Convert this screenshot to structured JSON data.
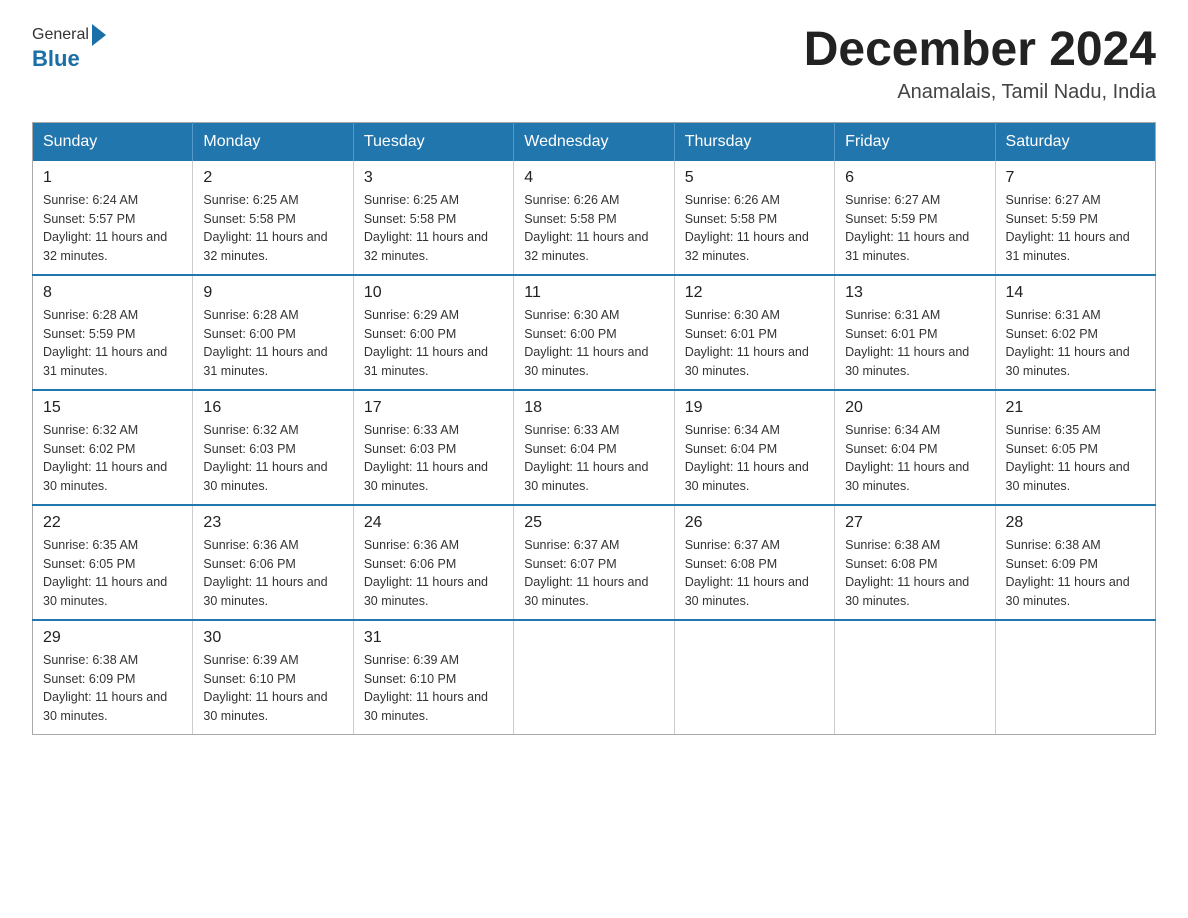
{
  "header": {
    "logo_general": "General",
    "logo_blue": "Blue",
    "month_title": "December 2024",
    "location": "Anamalais, Tamil Nadu, India"
  },
  "days_of_week": [
    "Sunday",
    "Monday",
    "Tuesday",
    "Wednesday",
    "Thursday",
    "Friday",
    "Saturday"
  ],
  "weeks": [
    [
      {
        "day": "1",
        "sunrise": "Sunrise: 6:24 AM",
        "sunset": "Sunset: 5:57 PM",
        "daylight": "Daylight: 11 hours and 32 minutes."
      },
      {
        "day": "2",
        "sunrise": "Sunrise: 6:25 AM",
        "sunset": "Sunset: 5:58 PM",
        "daylight": "Daylight: 11 hours and 32 minutes."
      },
      {
        "day": "3",
        "sunrise": "Sunrise: 6:25 AM",
        "sunset": "Sunset: 5:58 PM",
        "daylight": "Daylight: 11 hours and 32 minutes."
      },
      {
        "day": "4",
        "sunrise": "Sunrise: 6:26 AM",
        "sunset": "Sunset: 5:58 PM",
        "daylight": "Daylight: 11 hours and 32 minutes."
      },
      {
        "day": "5",
        "sunrise": "Sunrise: 6:26 AM",
        "sunset": "Sunset: 5:58 PM",
        "daylight": "Daylight: 11 hours and 32 minutes."
      },
      {
        "day": "6",
        "sunrise": "Sunrise: 6:27 AM",
        "sunset": "Sunset: 5:59 PM",
        "daylight": "Daylight: 11 hours and 31 minutes."
      },
      {
        "day": "7",
        "sunrise": "Sunrise: 6:27 AM",
        "sunset": "Sunset: 5:59 PM",
        "daylight": "Daylight: 11 hours and 31 minutes."
      }
    ],
    [
      {
        "day": "8",
        "sunrise": "Sunrise: 6:28 AM",
        "sunset": "Sunset: 5:59 PM",
        "daylight": "Daylight: 11 hours and 31 minutes."
      },
      {
        "day": "9",
        "sunrise": "Sunrise: 6:28 AM",
        "sunset": "Sunset: 6:00 PM",
        "daylight": "Daylight: 11 hours and 31 minutes."
      },
      {
        "day": "10",
        "sunrise": "Sunrise: 6:29 AM",
        "sunset": "Sunset: 6:00 PM",
        "daylight": "Daylight: 11 hours and 31 minutes."
      },
      {
        "day": "11",
        "sunrise": "Sunrise: 6:30 AM",
        "sunset": "Sunset: 6:00 PM",
        "daylight": "Daylight: 11 hours and 30 minutes."
      },
      {
        "day": "12",
        "sunrise": "Sunrise: 6:30 AM",
        "sunset": "Sunset: 6:01 PM",
        "daylight": "Daylight: 11 hours and 30 minutes."
      },
      {
        "day": "13",
        "sunrise": "Sunrise: 6:31 AM",
        "sunset": "Sunset: 6:01 PM",
        "daylight": "Daylight: 11 hours and 30 minutes."
      },
      {
        "day": "14",
        "sunrise": "Sunrise: 6:31 AM",
        "sunset": "Sunset: 6:02 PM",
        "daylight": "Daylight: 11 hours and 30 minutes."
      }
    ],
    [
      {
        "day": "15",
        "sunrise": "Sunrise: 6:32 AM",
        "sunset": "Sunset: 6:02 PM",
        "daylight": "Daylight: 11 hours and 30 minutes."
      },
      {
        "day": "16",
        "sunrise": "Sunrise: 6:32 AM",
        "sunset": "Sunset: 6:03 PM",
        "daylight": "Daylight: 11 hours and 30 minutes."
      },
      {
        "day": "17",
        "sunrise": "Sunrise: 6:33 AM",
        "sunset": "Sunset: 6:03 PM",
        "daylight": "Daylight: 11 hours and 30 minutes."
      },
      {
        "day": "18",
        "sunrise": "Sunrise: 6:33 AM",
        "sunset": "Sunset: 6:04 PM",
        "daylight": "Daylight: 11 hours and 30 minutes."
      },
      {
        "day": "19",
        "sunrise": "Sunrise: 6:34 AM",
        "sunset": "Sunset: 6:04 PM",
        "daylight": "Daylight: 11 hours and 30 minutes."
      },
      {
        "day": "20",
        "sunrise": "Sunrise: 6:34 AM",
        "sunset": "Sunset: 6:04 PM",
        "daylight": "Daylight: 11 hours and 30 minutes."
      },
      {
        "day": "21",
        "sunrise": "Sunrise: 6:35 AM",
        "sunset": "Sunset: 6:05 PM",
        "daylight": "Daylight: 11 hours and 30 minutes."
      }
    ],
    [
      {
        "day": "22",
        "sunrise": "Sunrise: 6:35 AM",
        "sunset": "Sunset: 6:05 PM",
        "daylight": "Daylight: 11 hours and 30 minutes."
      },
      {
        "day": "23",
        "sunrise": "Sunrise: 6:36 AM",
        "sunset": "Sunset: 6:06 PM",
        "daylight": "Daylight: 11 hours and 30 minutes."
      },
      {
        "day": "24",
        "sunrise": "Sunrise: 6:36 AM",
        "sunset": "Sunset: 6:06 PM",
        "daylight": "Daylight: 11 hours and 30 minutes."
      },
      {
        "day": "25",
        "sunrise": "Sunrise: 6:37 AM",
        "sunset": "Sunset: 6:07 PM",
        "daylight": "Daylight: 11 hours and 30 minutes."
      },
      {
        "day": "26",
        "sunrise": "Sunrise: 6:37 AM",
        "sunset": "Sunset: 6:08 PM",
        "daylight": "Daylight: 11 hours and 30 minutes."
      },
      {
        "day": "27",
        "sunrise": "Sunrise: 6:38 AM",
        "sunset": "Sunset: 6:08 PM",
        "daylight": "Daylight: 11 hours and 30 minutes."
      },
      {
        "day": "28",
        "sunrise": "Sunrise: 6:38 AM",
        "sunset": "Sunset: 6:09 PM",
        "daylight": "Daylight: 11 hours and 30 minutes."
      }
    ],
    [
      {
        "day": "29",
        "sunrise": "Sunrise: 6:38 AM",
        "sunset": "Sunset: 6:09 PM",
        "daylight": "Daylight: 11 hours and 30 minutes."
      },
      {
        "day": "30",
        "sunrise": "Sunrise: 6:39 AM",
        "sunset": "Sunset: 6:10 PM",
        "daylight": "Daylight: 11 hours and 30 minutes."
      },
      {
        "day": "31",
        "sunrise": "Sunrise: 6:39 AM",
        "sunset": "Sunset: 6:10 PM",
        "daylight": "Daylight: 11 hours and 30 minutes."
      },
      null,
      null,
      null,
      null
    ]
  ]
}
